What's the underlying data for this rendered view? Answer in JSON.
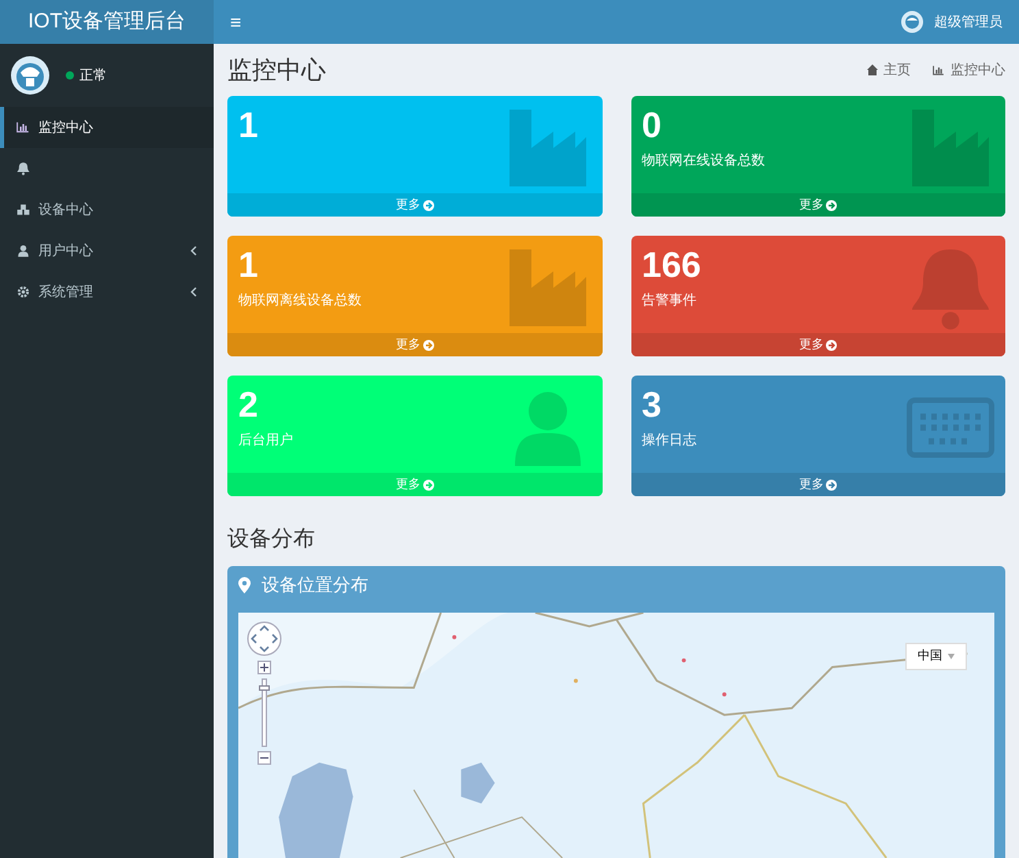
{
  "header": {
    "logo": "IOT设备管理后台",
    "menu_toggle": "≡",
    "user": "超级管理员"
  },
  "sidebar": {
    "status": "正常",
    "items": [
      {
        "label": "监控中心",
        "selected": true,
        "has_submenu": false
      },
      {
        "selected": false,
        "has_submenu": false
      },
      {
        "label": "设备中心",
        "selected": false,
        "has_submenu": false
      },
      {
        "label": "用户中心",
        "selected": false,
        "has_submenu": true
      },
      {
        "label": "系统管理",
        "selected": false,
        "has_submenu": true
      }
    ]
  },
  "page": {
    "title": "监控中心",
    "breadcrumb": [
      "主页",
      "监控中心"
    ]
  },
  "stat_cards": [
    {
      "value": "1",
      "more": "更多",
      "color": "#00c0ef"
    },
    {
      "value": "0",
      "label": "物联网在线设备总数",
      "more": "更多",
      "color": "#00a65a"
    },
    {
      "value": "1",
      "label": "物联网离线设备总数",
      "more": "更多",
      "color": "#f39c12"
    },
    {
      "value": "166",
      "label": "告警事件",
      "more": "更多",
      "color": "#dd4b39"
    },
    {
      "value": "2",
      "label": "后台用户",
      "more": "更多",
      "color": "#00ff77"
    },
    {
      "value": "3",
      "label": "操作日志",
      "more": "更多",
      "color": "#3c8dbc"
    }
  ],
  "section": {
    "title": "设备分布"
  },
  "map_panel": {
    "title": "设备位置分布",
    "zoom": {
      "level": 0.9
    },
    "region_select": "中国"
  }
}
